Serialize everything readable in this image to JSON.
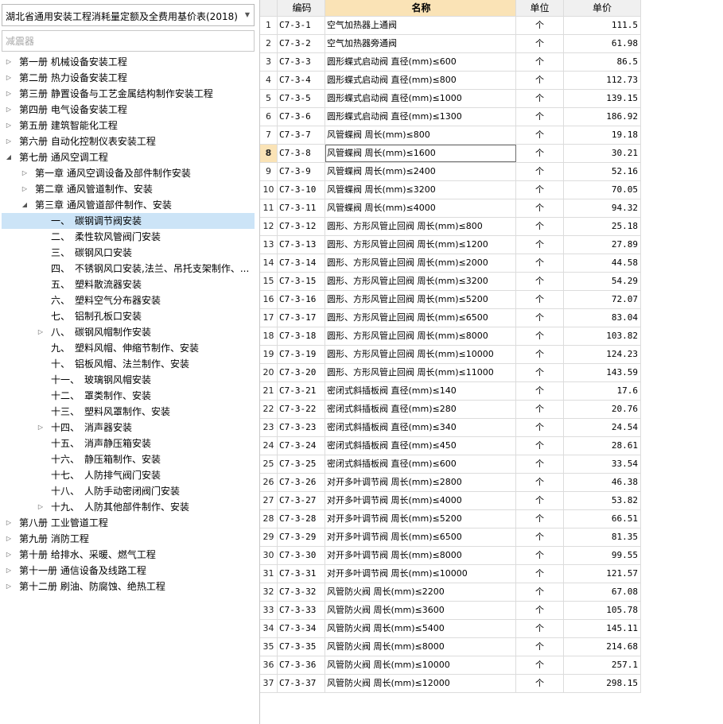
{
  "selector": {
    "value": "湖北省通用安装工程消耗量定额及全费用基价表(2018)"
  },
  "filter": {
    "placeholder": "减震器"
  },
  "tree": [
    {
      "label": "第一册 机械设备安装工程",
      "depth": 0,
      "toggle": "collapsed"
    },
    {
      "label": "第二册 热力设备安装工程",
      "depth": 0,
      "toggle": "collapsed"
    },
    {
      "label": "第三册 静置设备与工艺金属结构制作安装工程",
      "depth": 0,
      "toggle": "collapsed"
    },
    {
      "label": "第四册 电气设备安装工程",
      "depth": 0,
      "toggle": "collapsed"
    },
    {
      "label": "第五册 建筑智能化工程",
      "depth": 0,
      "toggle": "collapsed"
    },
    {
      "label": "第六册 自动化控制仪表安装工程",
      "depth": 0,
      "toggle": "collapsed"
    },
    {
      "label": "第七册 通风空调工程",
      "depth": 0,
      "toggle": "expanded"
    },
    {
      "label": "第一章 通风空调设备及部件制作安装",
      "depth": 1,
      "toggle": "collapsed"
    },
    {
      "label": "第二章 通风管道制作、安装",
      "depth": 1,
      "toggle": "collapsed"
    },
    {
      "label": "第三章 通风管道部件制作、安装",
      "depth": 1,
      "toggle": "expanded"
    },
    {
      "num": "一、",
      "label": "碳钢调节阀安装",
      "depth": 2,
      "toggle": "none",
      "selected": true
    },
    {
      "num": "二、",
      "label": "柔性软风管阀门安装",
      "depth": 2,
      "toggle": "none"
    },
    {
      "num": "三、",
      "label": "碳钢风口安装",
      "depth": 2,
      "toggle": "none"
    },
    {
      "num": "四、",
      "label": "不锈钢风口安装,法兰、吊托支架制作、...",
      "depth": 2,
      "toggle": "none"
    },
    {
      "num": "五、",
      "label": "塑料散流器安装",
      "depth": 2,
      "toggle": "none"
    },
    {
      "num": "六、",
      "label": "塑料空气分布器安装",
      "depth": 2,
      "toggle": "none"
    },
    {
      "num": "七、",
      "label": "铝制孔板口安装",
      "depth": 2,
      "toggle": "none"
    },
    {
      "num": "八、",
      "label": "碳钢风帽制作安装",
      "depth": 2,
      "toggle": "collapsed"
    },
    {
      "num": "九、",
      "label": "塑料风帽、伸缩节制作、安装",
      "depth": 2,
      "toggle": "none"
    },
    {
      "num": "十、",
      "label": "铝板风帽、法兰制作、安装",
      "depth": 2,
      "toggle": "none"
    },
    {
      "num": "十一、",
      "label": "玻璃钢风帽安装",
      "depth": 2,
      "toggle": "none"
    },
    {
      "num": "十二、",
      "label": "罩类制作、安装",
      "depth": 2,
      "toggle": "none"
    },
    {
      "num": "十三、",
      "label": "塑料风罩制作、安装",
      "depth": 2,
      "toggle": "none"
    },
    {
      "num": "十四、",
      "label": "消声器安装",
      "depth": 2,
      "toggle": "collapsed"
    },
    {
      "num": "十五、",
      "label": "消声静压箱安装",
      "depth": 2,
      "toggle": "none"
    },
    {
      "num": "十六、",
      "label": "静压箱制作、安装",
      "depth": 2,
      "toggle": "none"
    },
    {
      "num": "十七、",
      "label": "人防排气阀门安装",
      "depth": 2,
      "toggle": "none"
    },
    {
      "num": "十八、",
      "label": "人防手动密闭阀门安装",
      "depth": 2,
      "toggle": "none"
    },
    {
      "num": "十九、",
      "label": "人防其他部件制作、安装",
      "depth": 2,
      "toggle": "collapsed"
    },
    {
      "label": "第八册 工业管道工程",
      "depth": 0,
      "toggle": "collapsed"
    },
    {
      "label": "第九册 消防工程",
      "depth": 0,
      "toggle": "collapsed"
    },
    {
      "label": "第十册 给排水、采暖、燃气工程",
      "depth": 0,
      "toggle": "collapsed"
    },
    {
      "label": "第十一册 通信设备及线路工程",
      "depth": 0,
      "toggle": "collapsed"
    },
    {
      "label": "第十二册 刷油、防腐蚀、绝热工程",
      "depth": 0,
      "toggle": "collapsed"
    }
  ],
  "table": {
    "headers": {
      "code": "编码",
      "name": "名称",
      "unit": "单位",
      "price": "单价"
    },
    "active_row": 8,
    "rows": [
      [
        "1",
        "C7-3-1",
        "空气加热器上通阀",
        "个",
        "111.5"
      ],
      [
        "2",
        "C7-3-2",
        "空气加热器旁通阀",
        "个",
        "61.98"
      ],
      [
        "3",
        "C7-3-3",
        "圆形蝶式启动阀 直径(mm)≤600",
        "个",
        "86.5"
      ],
      [
        "4",
        "C7-3-4",
        "圆形蝶式启动阀 直径(mm)≤800",
        "个",
        "112.73"
      ],
      [
        "5",
        "C7-3-5",
        "圆形蝶式启动阀 直径(mm)≤1000",
        "个",
        "139.15"
      ],
      [
        "6",
        "C7-3-6",
        "圆形蝶式启动阀 直径(mm)≤1300",
        "个",
        "186.92"
      ],
      [
        "7",
        "C7-3-7",
        "风管蝶阀 周长(mm)≤800",
        "个",
        "19.18"
      ],
      [
        "8",
        "C7-3-8",
        "风管蝶阀 周长(mm)≤1600",
        "个",
        "30.21"
      ],
      [
        "9",
        "C7-3-9",
        "风管蝶阀 周长(mm)≤2400",
        "个",
        "52.16"
      ],
      [
        "10",
        "C7-3-10",
        "风管蝶阀 周长(mm)≤3200",
        "个",
        "70.05"
      ],
      [
        "11",
        "C7-3-11",
        "风管蝶阀 周长(mm)≤4000",
        "个",
        "94.32"
      ],
      [
        "12",
        "C7-3-12",
        "圆形、方形风管止回阀 周长(mm)≤800",
        "个",
        "25.18"
      ],
      [
        "13",
        "C7-3-13",
        "圆形、方形风管止回阀 周长(mm)≤1200",
        "个",
        "27.89"
      ],
      [
        "14",
        "C7-3-14",
        "圆形、方形风管止回阀 周长(mm)≤2000",
        "个",
        "44.58"
      ],
      [
        "15",
        "C7-3-15",
        "圆形、方形风管止回阀 周长(mm)≤3200",
        "个",
        "54.29"
      ],
      [
        "16",
        "C7-3-16",
        "圆形、方形风管止回阀 周长(mm)≤5200",
        "个",
        "72.07"
      ],
      [
        "17",
        "C7-3-17",
        "圆形、方形风管止回阀 周长(mm)≤6500",
        "个",
        "83.04"
      ],
      [
        "18",
        "C7-3-18",
        "圆形、方形风管止回阀 周长(mm)≤8000",
        "个",
        "103.82"
      ],
      [
        "19",
        "C7-3-19",
        "圆形、方形风管止回阀 周长(mm)≤10000",
        "个",
        "124.23"
      ],
      [
        "20",
        "C7-3-20",
        "圆形、方形风管止回阀 周长(mm)≤11000",
        "个",
        "143.59"
      ],
      [
        "21",
        "C7-3-21",
        "密闭式斜插板阀 直径(mm)≤140",
        "个",
        "17.6"
      ],
      [
        "22",
        "C7-3-22",
        "密闭式斜插板阀 直径(mm)≤280",
        "个",
        "20.76"
      ],
      [
        "23",
        "C7-3-23",
        "密闭式斜插板阀 直径(mm)≤340",
        "个",
        "24.54"
      ],
      [
        "24",
        "C7-3-24",
        "密闭式斜插板阀 直径(mm)≤450",
        "个",
        "28.61"
      ],
      [
        "25",
        "C7-3-25",
        "密闭式斜插板阀 直径(mm)≤600",
        "个",
        "33.54"
      ],
      [
        "26",
        "C7-3-26",
        "对开多叶调节阀 周长(mm)≤2800",
        "个",
        "46.38"
      ],
      [
        "27",
        "C7-3-27",
        "对开多叶调节阀 周长(mm)≤4000",
        "个",
        "53.82"
      ],
      [
        "28",
        "C7-3-28",
        "对开多叶调节阀 周长(mm)≤5200",
        "个",
        "66.51"
      ],
      [
        "29",
        "C7-3-29",
        "对开多叶调节阀 周长(mm)≤6500",
        "个",
        "81.35"
      ],
      [
        "30",
        "C7-3-30",
        "对开多叶调节阀 周长(mm)≤8000",
        "个",
        "99.55"
      ],
      [
        "31",
        "C7-3-31",
        "对开多叶调节阀 周长(mm)≤10000",
        "个",
        "121.57"
      ],
      [
        "32",
        "C7-3-32",
        "风管防火阀 周长(mm)≤2200",
        "个",
        "67.08"
      ],
      [
        "33",
        "C7-3-33",
        "风管防火阀 周长(mm)≤3600",
        "个",
        "105.78"
      ],
      [
        "34",
        "C7-3-34",
        "风管防火阀 周长(mm)≤5400",
        "个",
        "145.11"
      ],
      [
        "35",
        "C7-3-35",
        "风管防火阀 周长(mm)≤8000",
        "个",
        "214.68"
      ],
      [
        "36",
        "C7-3-36",
        "风管防火阀 周长(mm)≤10000",
        "个",
        "257.1"
      ],
      [
        "37",
        "C7-3-37",
        "风管防火阀 周长(mm)≤12000",
        "个",
        "298.15"
      ]
    ]
  }
}
